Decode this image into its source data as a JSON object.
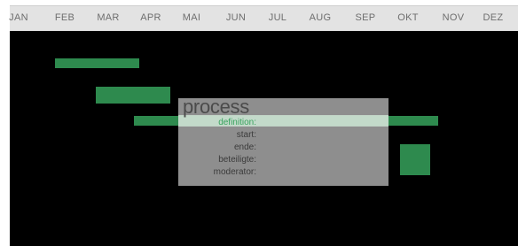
{
  "timeline": {
    "months": [
      "JAN",
      "FEB",
      "MAR",
      "APR",
      "MAI",
      "JUN",
      "JUL",
      "AUG",
      "SEP",
      "OKT",
      "NOV",
      "DEZ"
    ]
  },
  "colors": {
    "bar": "#2e8a4e",
    "background": "#000000",
    "header": "#e3e3e3",
    "active_label": "#39a35e"
  },
  "process_panel": {
    "title": "process",
    "fields": {
      "definition": "definition:",
      "start": "start:",
      "ende": "ende:",
      "beteiligte": "beteiligte:",
      "moderator": "moderator:"
    }
  }
}
